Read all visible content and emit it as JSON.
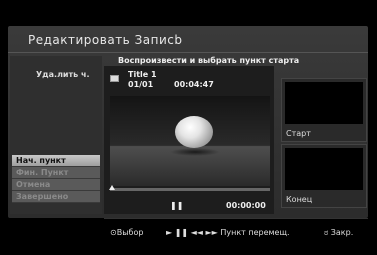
{
  "header": {
    "title": "Редактировать Записb"
  },
  "instruction": "Воспроизвести и выбрать пункт старта",
  "menu": {
    "delete_label": "Уда.лить ч.",
    "items": [
      {
        "label": "Нач. пункт",
        "state": "active"
      },
      {
        "label": "Фин. Пункт",
        "state": "disabled"
      },
      {
        "label": "Отмена",
        "state": "disabled"
      },
      {
        "label": "Завершено",
        "state": "disabled"
      }
    ]
  },
  "player": {
    "title": "Title 1",
    "chapter": "01/01",
    "duration": "00:04:47",
    "pause_symbol": "❚❚",
    "timecode": "00:00:00",
    "progress_fraction": 0.0
  },
  "thumbs": {
    "start_label": "Старт",
    "end_label": "Конец"
  },
  "footer": {
    "select_hint": "⊙Выбор",
    "playback_hint": "► ❚❚ ◄◄ ►► Пункт перемещ.",
    "close_hint": "ಠ Закр."
  },
  "colors": {
    "panel": "#333333",
    "active_item": "#bdbdbd",
    "disabled_item": "#5a5a5a"
  }
}
